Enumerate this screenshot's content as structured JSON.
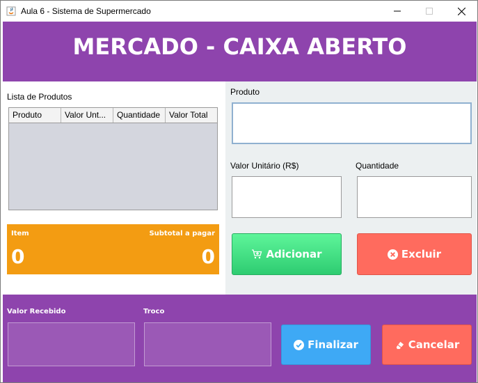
{
  "window": {
    "title": "Aula 6 - Sistema de Supermercado"
  },
  "header": {
    "title": "MERCADO - CAIXA ABERTO"
  },
  "products": {
    "label": "Lista de Produtos",
    "columns": [
      "Produto",
      "Valor Unt...",
      "Quantidade",
      "Valor Total"
    ],
    "rows": []
  },
  "summary": {
    "item_label": "Item",
    "item_value": "0",
    "subtotal_label": "Subtotal a pagar",
    "subtotal_value": "0"
  },
  "form": {
    "produto_label": "Produto",
    "produto_value": "",
    "valor_label": "Valor Unitário (R$)",
    "valor_value": "",
    "quantidade_label": "Quantidade",
    "quantidade_value": ""
  },
  "actions": {
    "adicionar": "Adicionar",
    "excluir": "Excluir",
    "finalizar": "Finalizar",
    "cancelar": "Cancelar"
  },
  "payment": {
    "recebido_label": "Valor Recebido",
    "recebido_value": "",
    "troco_label": "Troco",
    "troco_value": ""
  },
  "icons": {
    "adicionar": "cart-add-icon",
    "excluir": "circle-x-icon",
    "finalizar": "circle-check-icon",
    "cancelar": "eraser-icon"
  },
  "colors": {
    "purple": "#8e44ad",
    "orange": "#f39c12",
    "green": "#2ecc71",
    "red": "#ff6b5e",
    "blue": "#3ea9f5",
    "panel": "#ecf0f1"
  }
}
